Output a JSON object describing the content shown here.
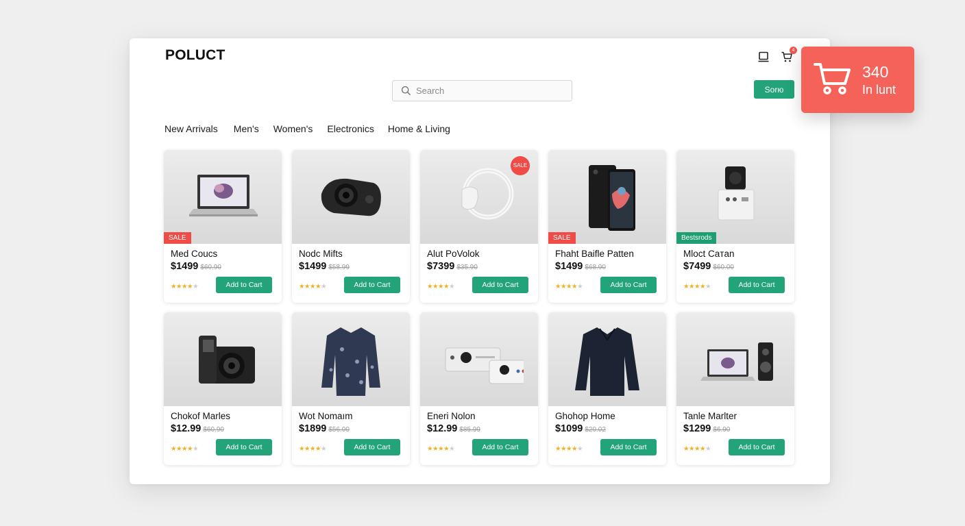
{
  "header": {
    "logo": "POLUCT",
    "search_placeholder": "Search",
    "sort_label": "Sorю",
    "cart_badge_count": "4"
  },
  "nav": {
    "items": [
      "New Arrivals",
      "Men's",
      "Women's",
      "Electronics",
      "Home & Living"
    ]
  },
  "cart_widget": {
    "count": "340",
    "label": "In lunt"
  },
  "colors": {
    "accent": "#22a37a",
    "sale": "#ef4b47",
    "cart_widget": "#f4625a"
  },
  "products": [
    {
      "name": "Med Coucs",
      "price": "$1499",
      "old_price": "$60.90",
      "badge": "SALE",
      "badge_type": "sale",
      "rating": 4,
      "image": "laptop-icon",
      "button": "Add to Cart"
    },
    {
      "name": "Nodc Mifts",
      "price": "$1499",
      "old_price": "$58.99",
      "badge": "",
      "badge_type": "",
      "rating": 4,
      "image": "camera-lens-icon",
      "button": "Add to Cart"
    },
    {
      "name": "Alut PoVolok",
      "price": "$7399",
      "old_price": "$35.90",
      "badge": "SALE",
      "badge_type": "round",
      "rating": 4,
      "image": "ring-light-icon",
      "button": "Add to Cart"
    },
    {
      "name": "Fhaht Baifle Patten",
      "price": "$1499",
      "old_price": "$68.90",
      "badge": "SALE",
      "badge_type": "sale",
      "rating": 4,
      "image": "smartphone-icon",
      "button": "Add to Cart"
    },
    {
      "name": "Mloct Caтan",
      "price": "$7499",
      "old_price": "$60.00",
      "badge": "Bestsrods",
      "badge_type": "green",
      "rating": 4,
      "image": "speaker-icon",
      "button": "Add to Cart"
    },
    {
      "name": "Chokof Marles",
      "price": "$12.99",
      "old_price": "$60.90",
      "badge": "",
      "badge_type": "",
      "rating": 4,
      "image": "camera-icon",
      "button": "Add to Cart"
    },
    {
      "name": "Wot Nomaım",
      "price": "$1899",
      "old_price": "$56.00",
      "badge": "",
      "badge_type": "",
      "rating": 4,
      "image": "shirt-icon",
      "button": "Add to Cart"
    },
    {
      "name": "Eneri Nolon",
      "price": "$12.99",
      "old_price": "$85.99",
      "badge": "",
      "badge_type": "",
      "rating": 4,
      "image": "projector-icon",
      "button": "Add to Cart"
    },
    {
      "name": "Ghohop Home",
      "price": "$1099",
      "old_price": "$20.02",
      "badge": "",
      "badge_type": "",
      "rating": 4,
      "image": "sweater-icon",
      "button": "Add to Cart"
    },
    {
      "name": "Tanle Marlter",
      "price": "$1299",
      "old_price": "$6.90",
      "badge": "",
      "badge_type": "",
      "rating": 4,
      "image": "laptop-speaker-icon",
      "button": "Add to Cart"
    }
  ]
}
